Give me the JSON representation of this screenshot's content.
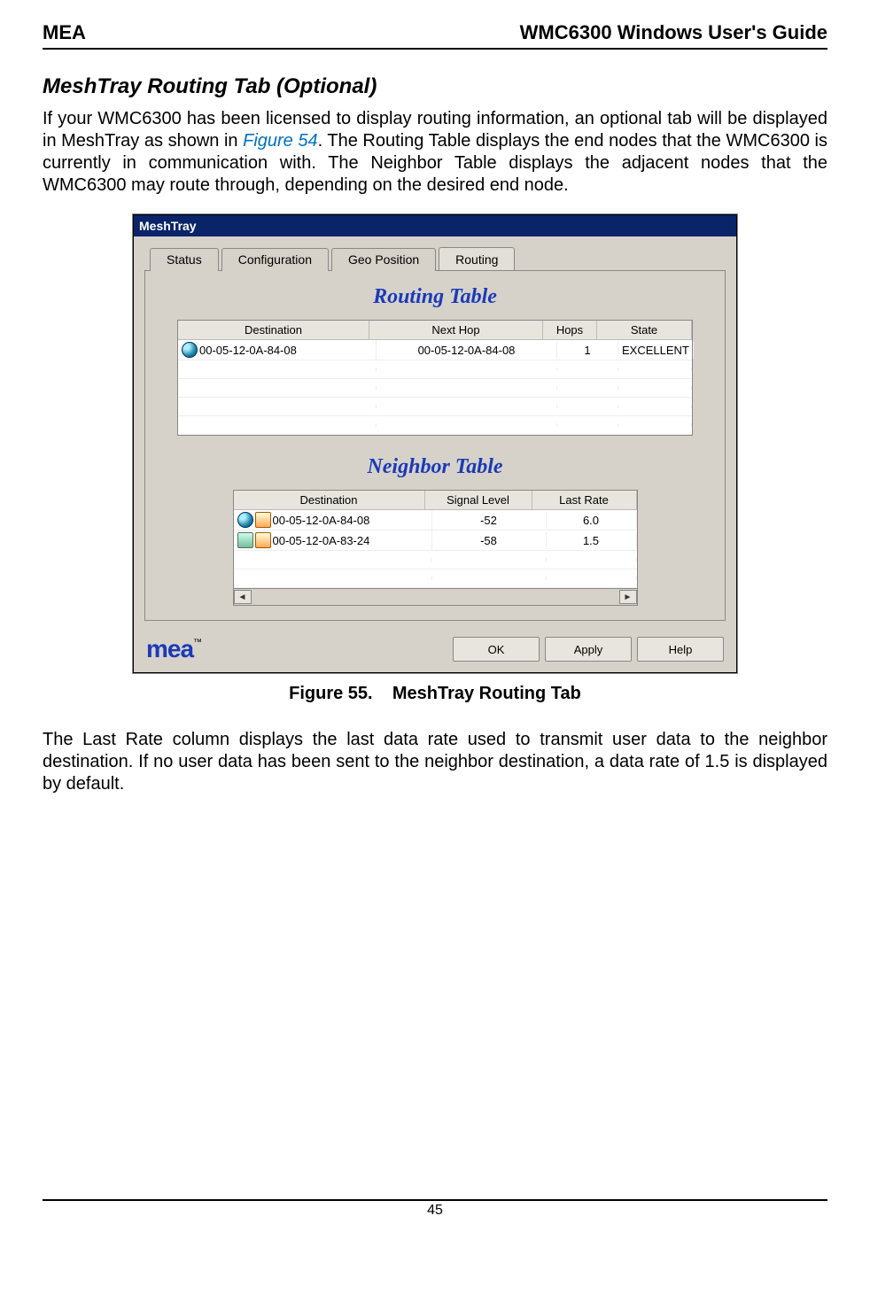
{
  "header": {
    "left": "MEA",
    "right": "WMC6300 Windows User's Guide"
  },
  "section_title": "MeshTray Routing Tab (Optional)",
  "para1_pre": "If your WMC6300 has been licensed to display routing information, an optional tab will be displayed in MeshTray as shown in ",
  "fig_link": "Figure 54",
  "para1_post": ".  The Routing Table displays the end nodes that the WMC6300 is currently in communication with.  The Neighbor Table displays the adjacent nodes that the WMC6300 may route through, depending on the desired end node.",
  "app": {
    "title": "MeshTray",
    "tabs": [
      "Status",
      "Configuration",
      "Geo Position",
      "Routing"
    ],
    "active_tab": 3,
    "routing_title": "Routing Table",
    "routing_headers": {
      "dest": "Destination",
      "next": "Next Hop",
      "hops": "Hops",
      "state": "State"
    },
    "routing_rows": [
      {
        "dest": "00-05-12-0A-84-08",
        "next": "00-05-12-0A-84-08",
        "hops": "1",
        "state": "EXCELLENT"
      }
    ],
    "neighbor_title": "Neighbor Table",
    "neighbor_headers": {
      "dest": "Destination",
      "sig": "Signal Level",
      "rate": "Last Rate"
    },
    "neighbor_rows": [
      {
        "dest": "00-05-12-0A-84-08",
        "sig": "-52",
        "rate": "6.0"
      },
      {
        "dest": "00-05-12-0A-83-24",
        "sig": "-58",
        "rate": "1.5"
      }
    ],
    "logo_text": "mea",
    "logo_tm": "™",
    "buttons": {
      "ok": "OK",
      "apply": "Apply",
      "help": "Help"
    }
  },
  "caption_label": "Figure 55.",
  "caption_text": "MeshTray Routing Tab",
  "para2": "The Last Rate column displays the last data rate used to transmit user data to the neighbor destination. If no user data has been sent to the neighbor destination, a data rate of 1.5 is displayed by default.",
  "page_number": "45"
}
